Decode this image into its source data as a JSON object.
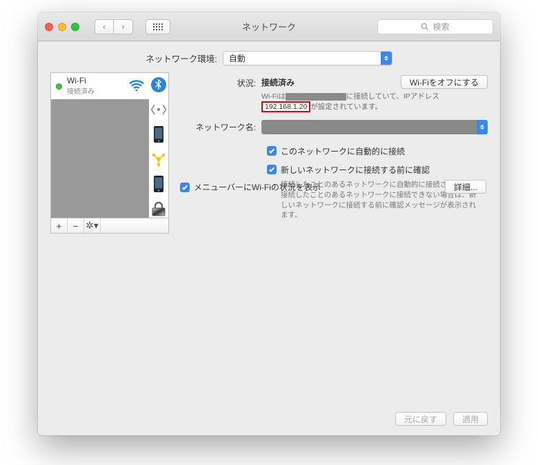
{
  "window": {
    "title": "ネットワーク"
  },
  "search": {
    "placeholder": "検索"
  },
  "location": {
    "label": "ネットワーク環境:",
    "value": "自動"
  },
  "sidebar": {
    "wifi": {
      "name": "Wi-Fi",
      "status": "接続済み"
    },
    "buttons": {
      "add": "+",
      "remove": "−",
      "gear": "✻▾"
    }
  },
  "status": {
    "label": "状況:",
    "value": "接続済み",
    "off_button": "Wi-Fiをオフにする",
    "info_prefix": "Wi-Fiは",
    "info_mid": "に接続していて、IPアドレス",
    "ip": "192.168.1.20",
    "info_suffix": "が設定されています。"
  },
  "network_name": {
    "label": "ネットワーク名:"
  },
  "checks": {
    "auto_join": "このネットワークに自動的に接続",
    "ask_join": "新しいネットワークに接続する前に確認",
    "ask_help": "接続したことのあるネットワークに自動的に接続されます。接続したことのあるネットワークに接続できない場合は、新しいネットワークに接続する前に確認メッセージが表示されます。",
    "menubar": "メニューバーにWi-Fiの状況を表示"
  },
  "advanced": "詳細...",
  "footer": {
    "revert": "元に戻す",
    "apply": "適用"
  }
}
